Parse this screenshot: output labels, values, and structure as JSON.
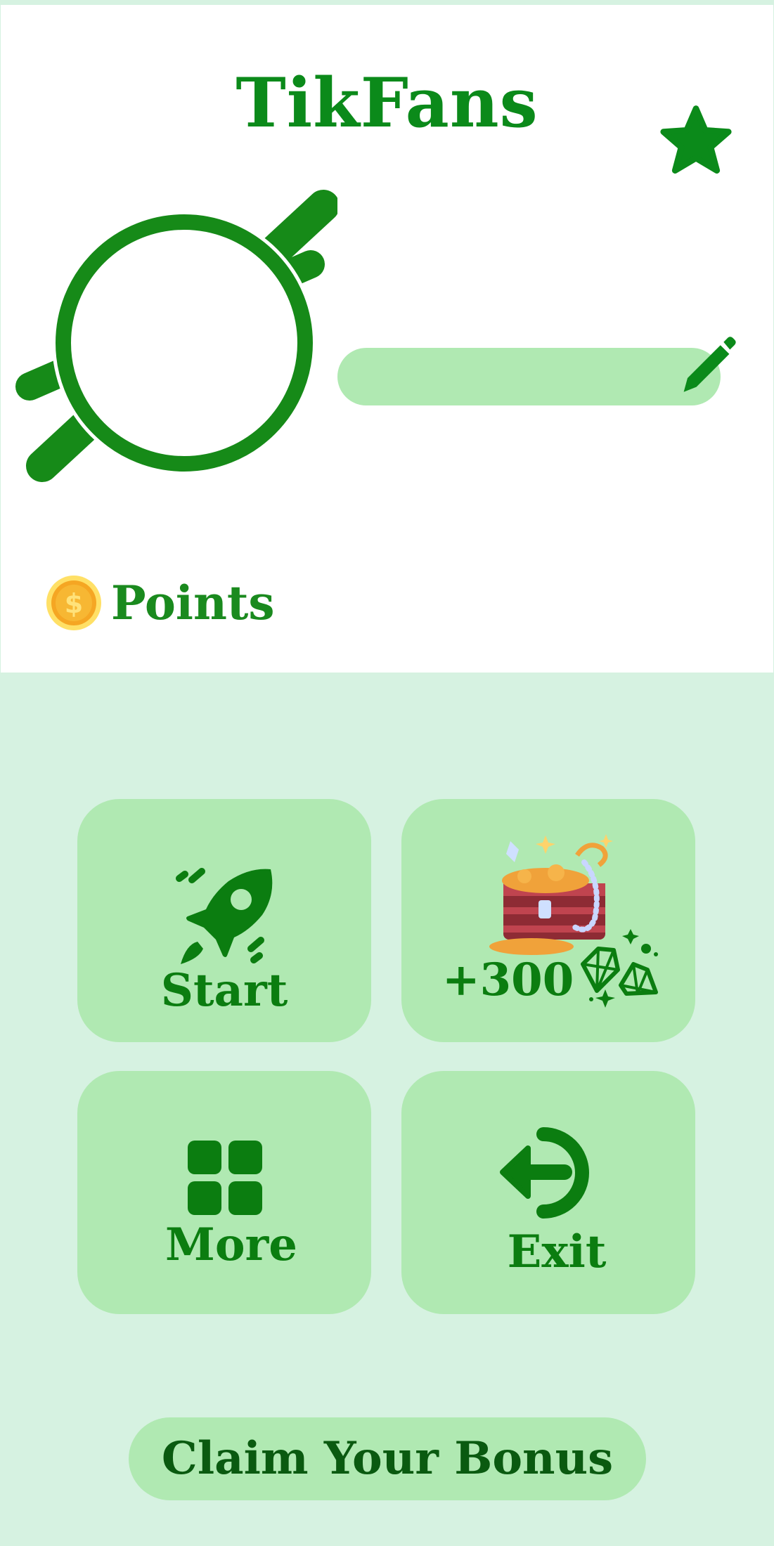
{
  "app": {
    "title": "TikFans"
  },
  "profile": {
    "name": "",
    "points_label": "Points"
  },
  "tiles": {
    "start": {
      "label": "Start"
    },
    "reward": {
      "label": "+300"
    },
    "more": {
      "label": "More"
    },
    "exit": {
      "label": "Exit"
    }
  },
  "bonus": {
    "label": "Claim Your Bonus"
  },
  "icons": [
    "star-icon",
    "planet-avatar-icon",
    "pencil-icon",
    "coin-icon",
    "rocket-icon",
    "treasure-chest-icon",
    "diamond-icon",
    "grid-icon",
    "exit-arrow-icon"
  ],
  "colors": {
    "primary_green": "#0b8a1a",
    "tile_green": "#b0e9b2",
    "background": "#d6f2e1"
  }
}
